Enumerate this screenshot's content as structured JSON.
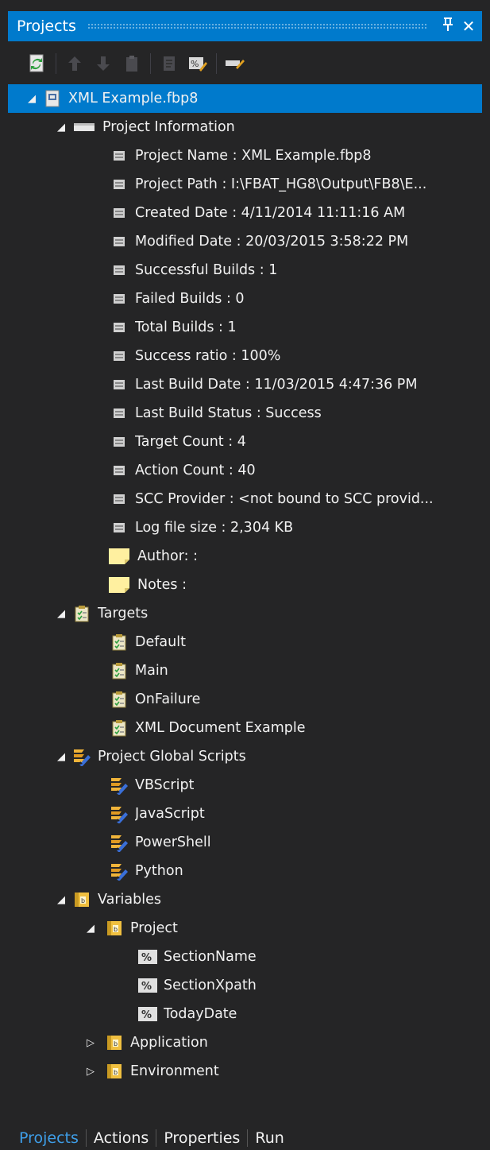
{
  "panel": {
    "title": "Projects",
    "pin_label": "Ͱ",
    "close_label": "✕"
  },
  "toolbar": {
    "icons": [
      "refresh-icon",
      "move-up-icon",
      "move-down-icon",
      "clipboard-icon",
      "properties-icon",
      "percent-variable-icon",
      "edit-icon"
    ]
  },
  "tree": {
    "root": {
      "label": "XML Example.fbp8"
    },
    "project_info": {
      "label": "Project Information",
      "items": [
        "Project Name : XML Example.fbp8",
        "Project Path : I:\\FBAT_HG8\\Output\\FB8\\E...",
        "Created Date : 4/11/2014 11:11:16 AM",
        "Modified Date : 20/03/2015 3:58:22 PM",
        "Successful Builds : 1",
        "Failed Builds : 0",
        "Total Builds : 1",
        "Success ratio : 100%",
        "Last Build Date : 11/03/2015 4:47:36 PM",
        "Last Build Status : Success",
        "Target Count : 4",
        "Action Count : 40",
        "SCC Provider : <not bound to SCC provid...",
        "Log file size : 2,304 KB"
      ],
      "notes": [
        "Author:  :",
        "Notes :"
      ]
    },
    "targets": {
      "label": "Targets",
      "items": [
        "Default",
        "Main",
        "OnFailure",
        "XML Document Example"
      ]
    },
    "scripts": {
      "label": "Project Global Scripts",
      "items": [
        "VBScript",
        "JavaScript",
        "PowerShell",
        "Python"
      ]
    },
    "variables": {
      "label": "Variables",
      "project": {
        "label": "Project",
        "items": [
          "SectionName",
          "SectionXpath",
          "TodayDate"
        ]
      },
      "application": {
        "label": "Application"
      },
      "environment": {
        "label": "Environment"
      }
    }
  },
  "tabs": [
    "Projects",
    "Actions",
    "Properties",
    "Run"
  ],
  "colors": {
    "accent": "#007acc",
    "background": "#252526",
    "text": "#f1f1f1",
    "active_tab": "#3e9ee8"
  }
}
